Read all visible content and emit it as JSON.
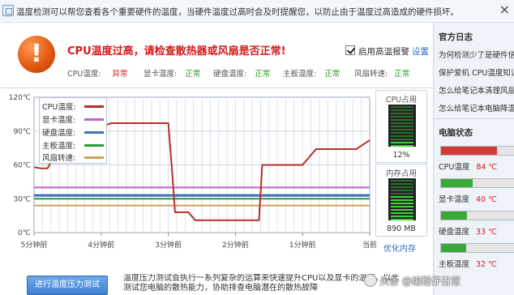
{
  "topbar": {
    "text": "温度检测可以帮您查看各个重要硬件的温度，当硬件温度过高时会及时提醒您，以防止由于温度过高造成的硬件损坏。",
    "close": "×"
  },
  "alert": {
    "icon_glyph": "!",
    "title": "CPU温度过高，请检查散热器或风扇是否正常!",
    "checkbox_label": "启用高温报警",
    "settings_link": "设置"
  },
  "statuses": [
    {
      "label": "CPU温度:",
      "value": "异常",
      "state": "bad"
    },
    {
      "label": "显卡温度:",
      "value": "正常",
      "state": "ok"
    },
    {
      "label": "硬盘温度:",
      "value": "正常",
      "state": "ok"
    },
    {
      "label": "主板温度:",
      "value": "正常",
      "state": "ok"
    },
    {
      "label": "风扇转速:",
      "value": "正常",
      "state": "ok"
    }
  ],
  "chart_data": {
    "type": "line",
    "ytick_labels": [
      "120℃",
      "90℃",
      "60℃",
      "30℃",
      "0℃"
    ],
    "xtick_labels": [
      "5分钟前",
      "4分钟前",
      "3分钟前",
      "2分钟前",
      "1分钟前",
      "当前"
    ],
    "ylim": [
      0,
      120
    ],
    "grid": true,
    "legend_position": "top-left",
    "series": [
      {
        "name": "CPU温度:",
        "color": "#b5302a",
        "x": [
          0,
          0.1,
          0.2,
          0.5,
          0.55,
          0.75,
          0.8,
          0.9,
          1.0,
          1.1,
          1.15,
          1.2,
          1.3,
          1.4,
          1.5,
          1.6,
          1.7,
          1.8,
          1.9,
          2.0,
          2.05,
          2.1,
          2.2,
          2.3,
          2.4,
          2.5,
          2.6,
          2.7,
          2.8,
          2.9,
          3.0,
          3.1,
          3.2,
          3.3,
          3.35,
          3.4,
          3.6,
          3.8,
          3.9,
          4.0,
          4.2,
          4.4,
          4.5,
          4.6,
          4.8,
          4.95,
          5.0
        ],
        "y": [
          58,
          57,
          57,
          90,
          93,
          93,
          94,
          95,
          95,
          96,
          97,
          97,
          97,
          97,
          97,
          97,
          97,
          97,
          97,
          97,
          60,
          18,
          18,
          18,
          11,
          11,
          11,
          11,
          11,
          11,
          11,
          11,
          11,
          11,
          11,
          60,
          60,
          60,
          60,
          60,
          74,
          74,
          74,
          74,
          74,
          80,
          82
        ]
      },
      {
        "name": "显卡温度:",
        "color": "#c262c2",
        "y": 40
      },
      {
        "name": "硬盘温度:",
        "color": "#3a6fc0",
        "y": 33
      },
      {
        "name": "主板温度:",
        "color": "#2a9a3a",
        "y": 30
      },
      {
        "name": "风扇转速:",
        "color": "#c9a35a",
        "y": 24
      }
    ]
  },
  "meters": {
    "cpu": {
      "title": "CPU占用",
      "value": "12%",
      "fraction": 0.12
    },
    "mem": {
      "title": "内存占用",
      "value": "890 MB",
      "fraction": 0.58
    },
    "optimize_link": "优化内存"
  },
  "bottom": {
    "test_button": "进行温度压力测试",
    "desc_line1": "温度压力测试会执行一系列复杂的运算来快速提升CPU以及显卡的温度，以此",
    "desc_line2": "测试您电脑的散热能力，协助排查电脑潜在的散热故障"
  },
  "sidebar": {
    "news_title": "官方日志",
    "news": [
      "为何检测少了是硬件信",
      "保护爱机 CPU温度知识",
      "怎么给笔记本清理风扇",
      "怎么给笔记本电脑降温"
    ],
    "status_title": "电脑状态",
    "stats": [
      {
        "label": "CPU温度",
        "value": "84 ℃",
        "color": "#d33a3a",
        "fraction": 0.7
      },
      {
        "label": "显卡温度",
        "value": "40 ℃",
        "color": "#3aa83a",
        "fraction": 0.4
      },
      {
        "label": "硬盘温度",
        "value": "33 ℃",
        "color": "#3aa83a",
        "fraction": 0.33
      },
      {
        "label": "主板温度",
        "value": "32 ℃",
        "color": "#3aa83a",
        "fraction": 0.32
      }
    ]
  },
  "watermark": "头条 @编程仔日常"
}
